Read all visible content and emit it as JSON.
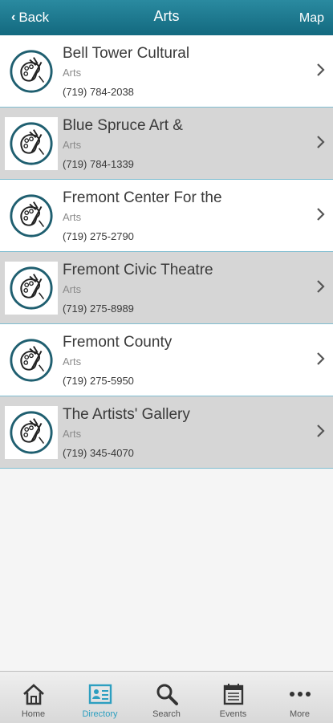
{
  "nav": {
    "back_label": "Back",
    "title": "Arts",
    "map_label": "Map"
  },
  "listings": [
    {
      "name": "Bell Tower Cultural",
      "category": "Arts",
      "phone": "(719) 784-2038"
    },
    {
      "name": "Blue Spruce Art &",
      "category": "Arts",
      "phone": "(719) 784-1339"
    },
    {
      "name": "Fremont Center For the",
      "category": "Arts",
      "phone": "(719) 275-2790"
    },
    {
      "name": "Fremont Civic Theatre",
      "category": "Arts",
      "phone": "(719) 275-8989"
    },
    {
      "name": "Fremont County",
      "category": "Arts",
      "phone": "(719) 275-5950"
    },
    {
      "name": "The Artists' Gallery",
      "category": "Arts",
      "phone": "(719) 345-4070"
    }
  ],
  "tabs": [
    {
      "label": "Home",
      "icon": "home-icon"
    },
    {
      "label": "Directory",
      "icon": "directory-icon",
      "active": true
    },
    {
      "label": "Search",
      "icon": "search-icon"
    },
    {
      "label": "Events",
      "icon": "calendar-icon"
    },
    {
      "label": "More",
      "icon": "more-icon"
    }
  ],
  "colors": {
    "header": "#13697f",
    "accent": "#2d9fc0",
    "row_alt": "#d6d6d6",
    "divider": "#7fbdd0"
  }
}
